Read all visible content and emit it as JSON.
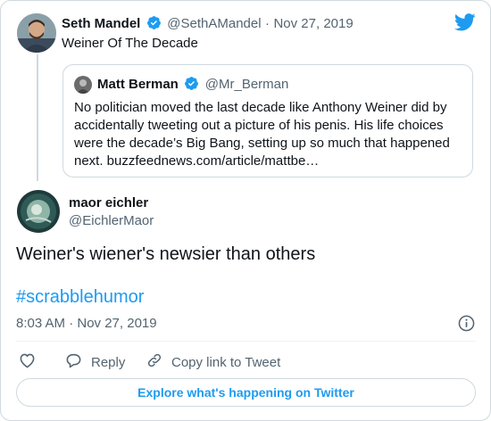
{
  "tweet": {
    "author": {
      "name": "Seth Mandel",
      "handle": "@SethAMandel",
      "date": "Nov 27, 2019"
    },
    "separator": "·",
    "text": "Weiner Of The Decade"
  },
  "quoted": {
    "author": {
      "name": "Matt Berman",
      "handle": "@Mr_Berman"
    },
    "text": "No politician moved the last decade like Anthony Weiner did by accidentally tweeting out a picture of his penis. His life choices were the decade’s Big Bang, setting up so much that happened next. buzzfeednews.com/article/mattbe…"
  },
  "reply": {
    "author": {
      "name": "maor eichler",
      "handle": "@EichlerMaor"
    },
    "text": "Weiner's wiener's newsier than others",
    "hashtag": "#scrabblehumor",
    "timestamp": "8:03 AM · Nov 27, 2019"
  },
  "actions": {
    "reply_label": "Reply",
    "copy_link_label": "Copy link to Tweet"
  },
  "footer": {
    "explore_label": "Explore what's happening on Twitter"
  },
  "colors": {
    "accent": "#1d9bf0",
    "text": "#0f1419",
    "muted": "#536471",
    "border": "#cfd9de"
  },
  "icons": [
    "twitter-bird-icon",
    "verified-badge-icon",
    "info-icon",
    "heart-icon",
    "reply-icon",
    "link-icon"
  ]
}
